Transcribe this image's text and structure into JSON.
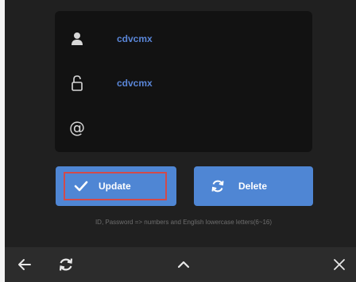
{
  "form": {
    "username_value": "cdvcmx",
    "password_value": "cdvcmx",
    "email_value": "",
    "email_icon_glyph": "@"
  },
  "buttons": {
    "update_label": "Update",
    "delete_label": "Delete"
  },
  "hint_text": "ID, Password => numbers and English lowercase letters(6~16)",
  "icons": {
    "user": "user-icon",
    "lock": "lock-open-icon",
    "at": "at-icon",
    "check": "check-icon",
    "refresh": "refresh-icon",
    "back": "back-arrow-icon",
    "up": "chevron-up-icon",
    "close": "close-icon"
  },
  "colors": {
    "background": "#202020",
    "card": "#121212",
    "button": "#4f86d4",
    "value_text": "#5a86d8",
    "focus_outline": "#d24a4a",
    "navbar": "#2c2c2c"
  }
}
